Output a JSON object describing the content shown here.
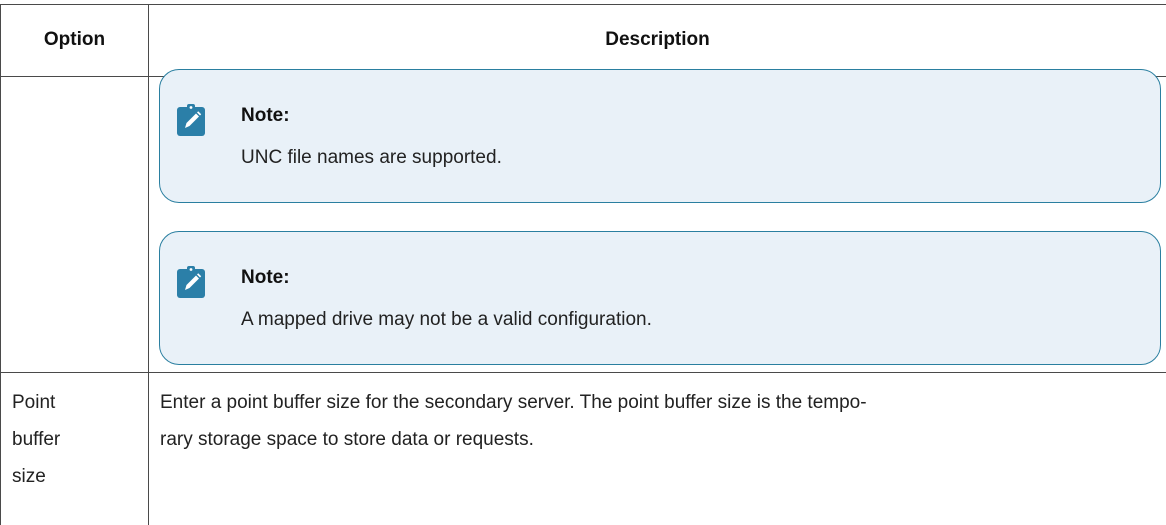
{
  "table": {
    "header": {
      "option": "Option",
      "description": "Description"
    },
    "notes": [
      {
        "title": "Note:",
        "body": "UNC file names are supported.",
        "icon": "note-pencil-icon"
      },
      {
        "title": "Note:",
        "body": "A mapped drive may not be a valid configuration.",
        "icon": "note-pencil-icon"
      }
    ],
    "rows": [
      {
        "option_lines": [
          "Point",
          "buffer",
          "size"
        ],
        "description_lines": [
          "Enter a point buffer size for the secondary server. The point buffer size is the tempo-",
          "rary storage space to store data or requests."
        ]
      }
    ]
  },
  "colors": {
    "note_border": "#2a7fa0",
    "note_background": "#e9f1f8",
    "icon": "#2b7fa8",
    "grid": "#4a4a4a"
  }
}
